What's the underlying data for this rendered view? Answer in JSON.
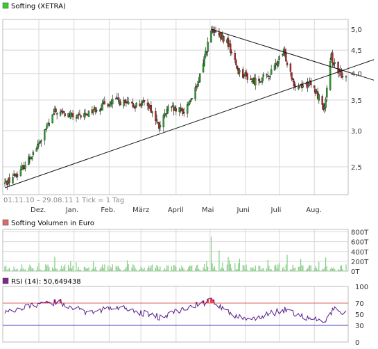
{
  "chart_data": [
    {
      "type": "candlestick",
      "title": "Softing (XETRA)",
      "footer": "01.11.10 – 29.08.11   1 Tick = 1 Tag",
      "x_tick_labels": [
        "Dez.",
        "Jan.",
        "Feb.",
        "März",
        "April",
        "Mai",
        "Juni",
        "Juli",
        "Aug."
      ],
      "y_tick_labels": [
        "5,0",
        "4,5",
        "4,0",
        "3,5",
        "3,0",
        "2,5"
      ],
      "y_ticks": [
        5.0,
        4.5,
        4.0,
        3.5,
        3.0,
        2.5
      ],
      "ylim": [
        2.2,
        5.3
      ],
      "log_scale": true,
      "date_range": [
        "2010-11-01",
        "2011-08-29"
      ],
      "key_points": [
        {
          "date": "2010-11-01",
          "value": 2.3
        },
        {
          "date": "2010-11-15",
          "value": 2.45
        },
        {
          "date": "2010-12-01",
          "value": 2.8
        },
        {
          "date": "2010-12-15",
          "value": 3.3
        },
        {
          "date": "2011-01-05",
          "value": 3.2
        },
        {
          "date": "2011-01-20",
          "value": 3.35
        },
        {
          "date": "2011-02-07",
          "value": 3.5
        },
        {
          "date": "2011-02-20",
          "value": 3.4
        },
        {
          "date": "2011-03-07",
          "value": 3.45
        },
        {
          "date": "2011-03-17",
          "value": 3.05
        },
        {
          "date": "2011-03-25",
          "value": 3.35
        },
        {
          "date": "2011-04-08",
          "value": 3.3
        },
        {
          "date": "2011-04-20",
          "value": 3.75
        },
        {
          "date": "2011-05-02",
          "value": 4.95
        },
        {
          "date": "2011-05-16",
          "value": 4.7
        },
        {
          "date": "2011-05-26",
          "value": 4.05
        },
        {
          "date": "2011-06-08",
          "value": 3.85
        },
        {
          "date": "2011-06-22",
          "value": 3.95
        },
        {
          "date": "2011-07-05",
          "value": 4.45
        },
        {
          "date": "2011-07-15",
          "value": 3.75
        },
        {
          "date": "2011-07-28",
          "value": 3.8
        },
        {
          "date": "2011-08-05",
          "value": 3.55
        },
        {
          "date": "2011-08-10",
          "value": 3.35
        },
        {
          "date": "2011-08-16",
          "value": 4.35
        },
        {
          "date": "2011-08-22",
          "value": 4.0
        },
        {
          "date": "2011-08-29",
          "value": 3.95
        }
      ],
      "trendlines": [
        {
          "from": {
            "date": "2010-11-01",
            "value": 2.25
          },
          "to": {
            "date": "2011-08-29",
            "value": 4.0
          }
        },
        {
          "from": {
            "date": "2011-05-02",
            "value": 5.0
          },
          "to": {
            "date": "2011-08-29",
            "value": 3.95
          }
        }
      ]
    },
    {
      "type": "bar",
      "title": "Softing Volumen in Euro",
      "y_tick_labels": [
        "800T",
        "600T",
        "400T",
        "200T",
        "0T"
      ],
      "ylim": [
        0,
        850
      ],
      "unit": "T",
      "peaks": [
        {
          "date": "2011-05-02",
          "value": 700
        },
        {
          "date": "2011-05-09",
          "value": 420
        },
        {
          "date": "2011-07-08",
          "value": 330
        },
        {
          "date": "2011-08-11",
          "value": 280
        }
      ]
    },
    {
      "type": "line",
      "title": "RSI (14): 50,649438",
      "y_tick_labels": [
        "100",
        "70",
        "50",
        "30",
        "0"
      ],
      "y_ticks": [
        100,
        70,
        50,
        30,
        0
      ],
      "ylim": [
        0,
        100
      ],
      "reference_lines": [
        70,
        30
      ],
      "last_value": 50.649438,
      "key_points": [
        {
          "date": "2010-11-01",
          "value": 55
        },
        {
          "date": "2010-12-10",
          "value": 70
        },
        {
          "date": "2010-12-20",
          "value": 72
        },
        {
          "date": "2011-01-10",
          "value": 55
        },
        {
          "date": "2011-02-10",
          "value": 62
        },
        {
          "date": "2011-03-17",
          "value": 45
        },
        {
          "date": "2011-04-20",
          "value": 67
        },
        {
          "date": "2011-05-02",
          "value": 75
        },
        {
          "date": "2011-05-20",
          "value": 48
        },
        {
          "date": "2011-06-10",
          "value": 42
        },
        {
          "date": "2011-07-05",
          "value": 58
        },
        {
          "date": "2011-07-25",
          "value": 45
        },
        {
          "date": "2011-08-10",
          "value": 35
        },
        {
          "date": "2011-08-18",
          "value": 60
        },
        {
          "date": "2011-08-29",
          "value": 50.6
        }
      ]
    }
  ],
  "colors": {
    "up": "#22aa22",
    "down": "#cc2222",
    "volume": "#7fcf7f",
    "rsi_line": "#551a8b",
    "rsi_70": "#e06060",
    "rsi_30": "#4040c0",
    "overbought_fill": "#ff4444",
    "grid": "#d8d8d8",
    "title_swatch_price": "#33cc33",
    "title_swatch_volume": "#d96b6b",
    "title_swatch_rsi": "#7b2a8b"
  }
}
